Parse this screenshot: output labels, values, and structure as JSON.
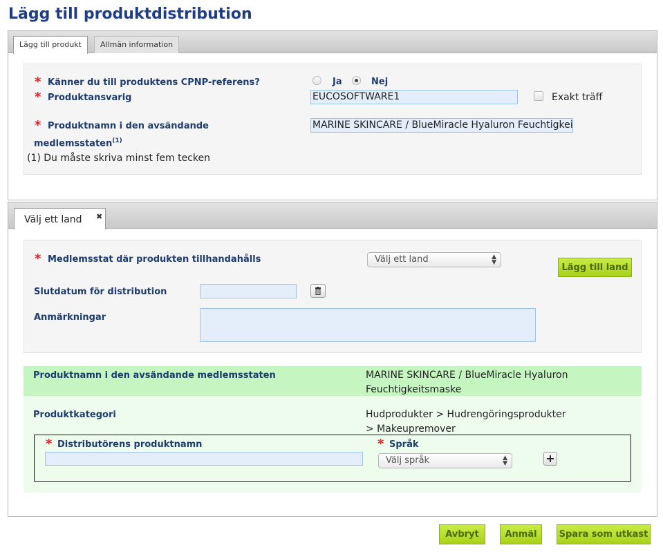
{
  "page_title": "Lägg till produktdistribution",
  "tabs_top": [
    {
      "label": "Lägg till produkt"
    },
    {
      "label": "Allmän information"
    }
  ],
  "product_form": {
    "cpnp_question": "Känner du till produktens CPNP-referens?",
    "radio_yes": "Ja",
    "radio_no": "Nej",
    "selected": "Nej",
    "responsible_label": "Produktansvarig",
    "responsible_value": "EUCOSOFTWARE1",
    "exact_match_label": "Exakt träff",
    "name_label_line1": "Produktnamn i den avsändande",
    "name_label_line2": "medlemsstaten",
    "name_label_sup": "(1)",
    "name_value": "MARINE SKINCARE / BlueMiracle Hyaluron Feuchtigkeitsmaske",
    "footnote": "(1) Du måste skriva minst fem tecken"
  },
  "country_tab": {
    "label": "Välj ett land",
    "close": "✖"
  },
  "country_form": {
    "member_state_label": "Medlemsstat där produkten tillhandahålls",
    "country_select": "Välj ett land",
    "add_country_button": "Lägg till land",
    "end_date_label": "Slutdatum för distribution",
    "end_date_value": "",
    "remarks_label": "Anmärkningar",
    "remarks_value": ""
  },
  "product_info": {
    "name_label": "Produktnamn i den avsändande medlemsstaten",
    "name_value_line1": "MARINE SKINCARE / BlueMiracle Hyaluron",
    "name_value_line2": "Feuchtigkeitsmaske",
    "category_label": "Produktkategori",
    "category_value_line1": "Hudprodukter > Hudrengöringsprodukter",
    "category_value_line2": "> Makeupremover"
  },
  "distributor": {
    "name_label": "Distributörens produktnamn",
    "name_value": "",
    "language_label": "Språk",
    "language_select": "Välj språk",
    "add_symbol": "+"
  },
  "footer_buttons": {
    "cancel": "Avbryt",
    "submit": "Anmäl",
    "save_draft": "Spara som utkast"
  },
  "colors": {
    "title": "#1f3c88",
    "label": "#1f3c6e",
    "required": "#d9252b",
    "green_button": "#b5dc2b",
    "info_band": "#c5f5c0",
    "info_area": "#eefcee",
    "input_bg": "#e3eefa"
  }
}
